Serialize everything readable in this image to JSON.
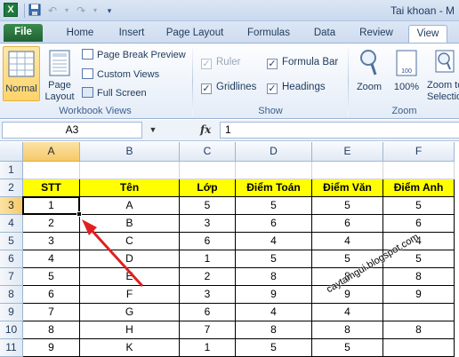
{
  "titlebar": {
    "app_icon": "excel-icon",
    "title": "Tai khoan  -  M",
    "quick_access": [
      "save-icon",
      "undo-icon",
      "redo-icon",
      "customize-icon"
    ]
  },
  "tabs": [
    {
      "label": "File"
    },
    {
      "label": "Home"
    },
    {
      "label": "Insert"
    },
    {
      "label": "Page Layout"
    },
    {
      "label": "Formulas"
    },
    {
      "label": "Data"
    },
    {
      "label": "Review"
    },
    {
      "label": "View"
    }
  ],
  "ribbon": {
    "workbook_views": {
      "label": "Workbook Views",
      "normal": "Normal",
      "page_layout_1": "Page",
      "page_layout_2": "Layout",
      "page_break_preview": "Page Break Preview",
      "custom_views": "Custom Views",
      "full_screen": "Full Screen"
    },
    "show": {
      "label": "Show",
      "ruler": "Ruler",
      "gridlines": "Gridlines",
      "formula_bar": "Formula Bar",
      "headings": "Headings"
    },
    "zoom": {
      "label": "Zoom",
      "zoom": "Zoom",
      "hundred": "100%",
      "zoom_sel_1": "Zoom to",
      "zoom_sel_2": "Selection"
    }
  },
  "formula_bar": {
    "name_box": "A3",
    "fx": "fx",
    "value": "1"
  },
  "sheet": {
    "columns": [
      "A",
      "B",
      "C",
      "D",
      "E",
      "F"
    ],
    "rows": [
      "1",
      "2",
      "3",
      "4",
      "5",
      "6",
      "7",
      "8",
      "9",
      "10",
      "11"
    ],
    "header": [
      "STT",
      "Tên",
      "Lớp",
      "Điểm Toán",
      "Điểm Văn",
      "Điểm Anh"
    ],
    "data": [
      [
        "1",
        "A",
        "5",
        "5",
        "5",
        "5"
      ],
      [
        "2",
        "B",
        "3",
        "6",
        "6",
        "6"
      ],
      [
        "3",
        "C",
        "6",
        "4",
        "4",
        "4"
      ],
      [
        "4",
        "D",
        "1",
        "5",
        "5",
        "5"
      ],
      [
        "5",
        "E",
        "2",
        "8",
        "8",
        "8"
      ],
      [
        "6",
        "F",
        "3",
        "9",
        "9",
        "9"
      ],
      [
        "7",
        "G",
        "6",
        "4",
        "4",
        ""
      ],
      [
        "8",
        "H",
        "7",
        "8",
        "8",
        "8"
      ],
      [
        "9",
        "K",
        "1",
        "5",
        "5",
        ""
      ]
    ]
  },
  "watermark": "caytamgui.blogspot.com",
  "colors": {
    "header_fill": "#ffff00",
    "selected_header": "#f6c96a",
    "arrow": "#e02020",
    "file_tab": "#2c6a3a"
  }
}
